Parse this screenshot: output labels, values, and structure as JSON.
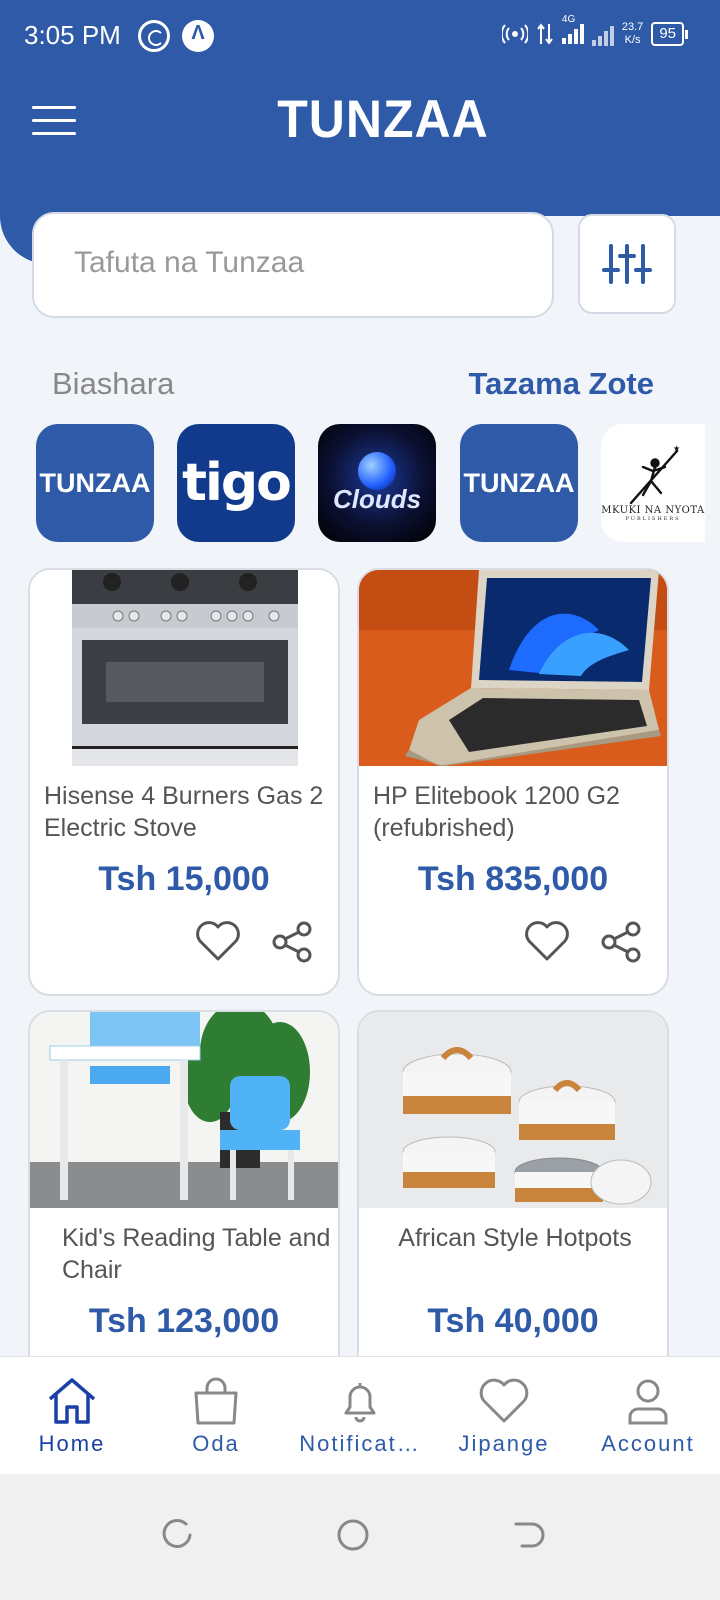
{
  "status_bar": {
    "time": "3:05 PM",
    "network": "4G",
    "speed_value": "23.7",
    "speed_unit": "K/s",
    "battery": "95"
  },
  "header": {
    "title": "TUNZAA",
    "background_color": "#2f5aa8"
  },
  "search": {
    "placeholder": "Tafuta na Tunzaa"
  },
  "brands_section": {
    "title": "Biashara",
    "see_all_label": "Tazama Zote",
    "brands": [
      {
        "label": "TUNZAA",
        "icon": "tunzaa-logo"
      },
      {
        "label": "tigo",
        "icon": "tigo-logo"
      },
      {
        "label": "Clouds",
        "icon": "clouds-logo"
      },
      {
        "label": "TUNZAA",
        "icon": "tunzaa-logo"
      },
      {
        "label": "Mkuki na Nyota",
        "sublabel": "PUBLISHERS",
        "icon": "mkuki-logo"
      }
    ]
  },
  "products": [
    {
      "name": "Hisense 4 Burners Gas 2 Electric Stove",
      "price": "Tsh 15,000",
      "image": "gas-stove"
    },
    {
      "name": "HP Elitebook 1200 G2 (refubrished)",
      "price": "Tsh 835,000",
      "image": "laptop"
    },
    {
      "name": "Kid's Reading Table and Chair",
      "price": "Tsh 123,000",
      "image": "kids-table"
    },
    {
      "name": "African Style Hotpots",
      "price": "Tsh 40,000",
      "image": "hotpots"
    }
  ],
  "bottom_nav": [
    {
      "label": "Home",
      "icon": "home-icon",
      "active": true
    },
    {
      "label": "Oda",
      "icon": "bag-icon"
    },
    {
      "label": "Notificat…",
      "icon": "bell-icon"
    },
    {
      "label": "Jipange",
      "icon": "heart-icon"
    },
    {
      "label": "Account",
      "icon": "user-icon"
    }
  ]
}
